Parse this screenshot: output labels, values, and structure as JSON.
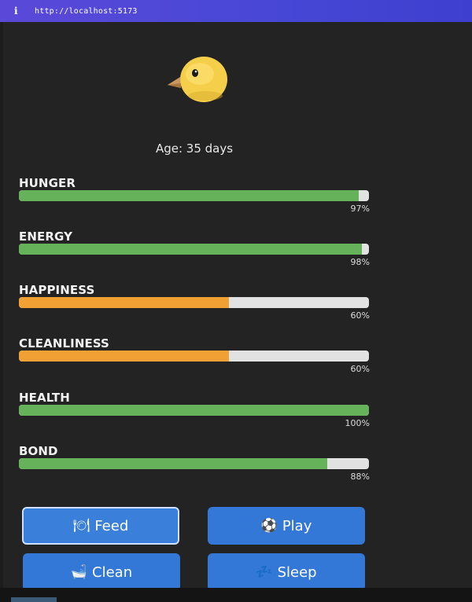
{
  "browser": {
    "info_icon": "i",
    "url": "http://localhost:5173"
  },
  "pet": {
    "icon": "chick-icon",
    "age_text": "Age: 35 days"
  },
  "stats": [
    {
      "label": "HUNGER",
      "percent_text": "97%",
      "value": 97,
      "color": "#66b25a"
    },
    {
      "label": "ENERGY",
      "percent_text": "98%",
      "value": 98,
      "color": "#66b25a"
    },
    {
      "label": "HAPPINESS",
      "percent_text": "60%",
      "value": 60,
      "color": "#f1a033"
    },
    {
      "label": "CLEANLINESS",
      "percent_text": "60%",
      "value": 60,
      "color": "#f1a033"
    },
    {
      "label": "HEALTH",
      "percent_text": "100%",
      "value": 100,
      "color": "#66b25a"
    },
    {
      "label": "BOND",
      "percent_text": "88%",
      "value": 88,
      "color": "#66b25a"
    }
  ],
  "actions": [
    {
      "label": "Feed",
      "icon": "🍽",
      "icon_name": "plate-icon"
    },
    {
      "label": "Play",
      "icon": "⚽",
      "icon_name": "soccer-ball-icon"
    },
    {
      "label": "Clean",
      "icon": "🛁",
      "icon_name": "bathtub-icon"
    },
    {
      "label": "Sleep",
      "icon": "💤",
      "icon_name": "zzz-icon"
    }
  ],
  "colors": {
    "good": "#66b25a",
    "warning": "#f1a033",
    "button": "#3378d6",
    "background": "#232323"
  }
}
